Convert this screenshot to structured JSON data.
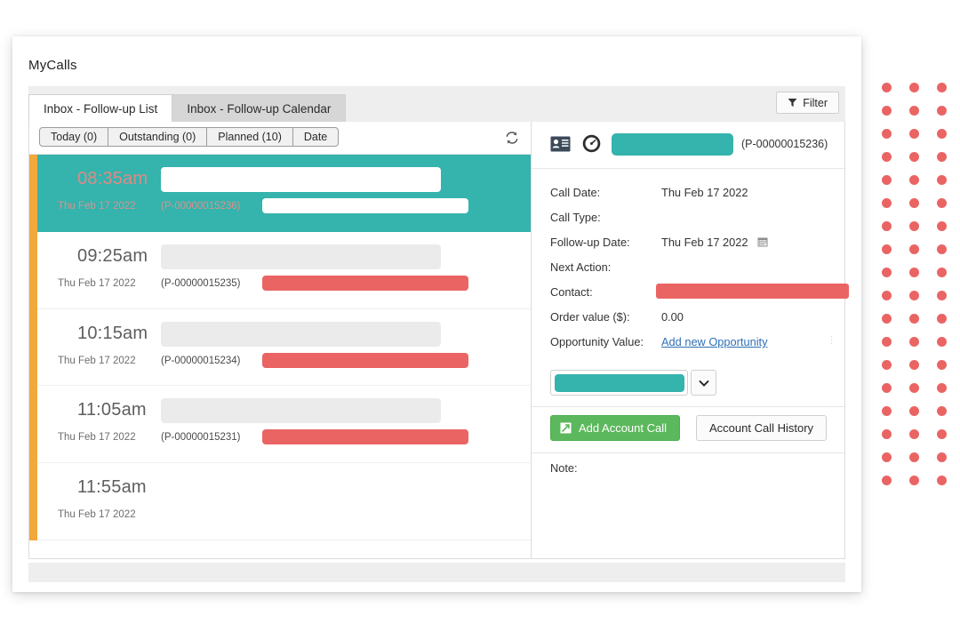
{
  "card": {
    "title": "MyCalls"
  },
  "tabs": [
    {
      "label": "Inbox - Follow-up List",
      "active": true
    },
    {
      "label": "Inbox - Follow-up Calendar",
      "active": false
    }
  ],
  "filter": {
    "label": "Filter",
    "icon": "funnel-icon"
  },
  "subtabs": [
    {
      "label": "Today (0)"
    },
    {
      "label": "Outstanding (0)"
    },
    {
      "label": "Planned (10)"
    },
    {
      "label": "Date"
    }
  ],
  "refresh": {
    "icon": "refresh-icon"
  },
  "list": {
    "accent_color": "#f2a93b",
    "selected_color": "#35b3ad",
    "redact_color": "#ea6464",
    "rows": [
      {
        "time": "08:35am",
        "date": "Thu Feb 17 2022",
        "ref": "(P-00000015236)",
        "selected": true,
        "has_title_bar": true,
        "has_sub_bar": true
      },
      {
        "time": "09:25am",
        "date": "Thu Feb 17 2022",
        "ref": "(P-00000015235)",
        "selected": false,
        "has_title_bar": true,
        "has_sub_bar": true
      },
      {
        "time": "10:15am",
        "date": "Thu Feb 17 2022",
        "ref": "(P-00000015234)",
        "selected": false,
        "has_title_bar": true,
        "has_sub_bar": true
      },
      {
        "time": "11:05am",
        "date": "Thu Feb 17 2022",
        "ref": "(P-00000015231)",
        "selected": false,
        "has_title_bar": true,
        "has_sub_bar": true
      },
      {
        "time": "11:55am",
        "date": "Thu Feb 17 2022",
        "ref": "",
        "selected": false,
        "has_title_bar": false,
        "has_sub_bar": false
      }
    ]
  },
  "detail": {
    "header": {
      "contact_icon": "contact-card-icon",
      "gauge_icon": "gauge-icon",
      "reference": "(P-00000015236)"
    },
    "fields": [
      {
        "label": "Call Date:",
        "value": "Thu Feb 17 2022",
        "type": "text"
      },
      {
        "label": "Call Type:",
        "value": "",
        "type": "text"
      },
      {
        "label": "Follow-up Date:",
        "value": "Thu Feb 17 2022",
        "type": "date",
        "icon": "calendar-icon"
      },
      {
        "label": "Next Action:",
        "value": "",
        "type": "text"
      },
      {
        "label": "Contact:",
        "value": "",
        "type": "redacted"
      },
      {
        "label": "Order value ($):",
        "value": "0.00",
        "type": "text"
      },
      {
        "label": "Opportunity Value:",
        "value": "Add new Opportunity",
        "type": "link"
      }
    ],
    "select": {
      "value": "",
      "caret_icon": "chevron-down-icon"
    },
    "buttons": {
      "add_call": "Add Account Call",
      "add_call_icon": "add-call-icon",
      "call_history": "Account Call History"
    },
    "note": {
      "label": "Note:",
      "value": ""
    }
  },
  "decoration": {
    "dot_color": "#ea6464",
    "groups": 6,
    "rows_per_group": 3,
    "cols": 3
  }
}
